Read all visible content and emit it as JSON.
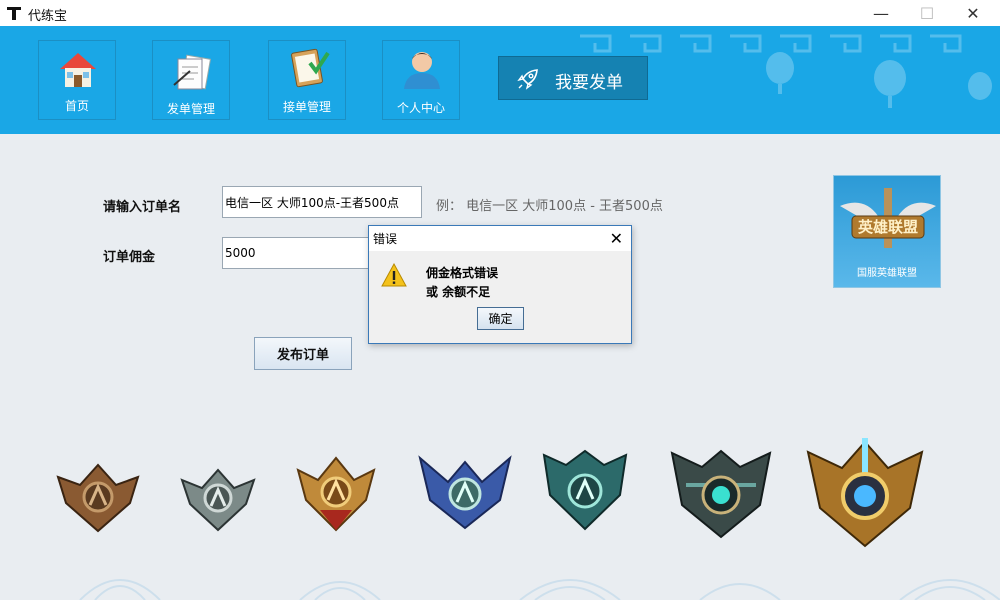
{
  "window": {
    "title": "代练宝",
    "min_icon": "minimize-icon",
    "max_icon": "maximize-icon",
    "close_icon": "close-icon"
  },
  "nav": [
    {
      "label": "首页",
      "icon": "home-icon"
    },
    {
      "label": "发单管理",
      "icon": "documents-icon"
    },
    {
      "label": "接单管理",
      "icon": "clipboard-check-icon"
    },
    {
      "label": "个人中心",
      "icon": "user-icon"
    }
  ],
  "publish_button": {
    "label": "我要发单",
    "icon": "rocket-icon"
  },
  "form": {
    "order_name_label": "请输入订单名",
    "order_name_value": "电信一区 大师100点-王者500点",
    "hint": "例：  电信一区 大师100点 - 王者500点",
    "commission_label": "订单佣金",
    "commission_value": "5000",
    "submit_label": "发布订单"
  },
  "logo": {
    "image_text": "英雄联盟",
    "caption": "国服英雄联盟"
  },
  "dialog": {
    "title": "错误",
    "message_line1": "佣金格式错误",
    "message_line2": "或 余额不足",
    "ok_label": "确定",
    "icon": "warning-icon"
  },
  "emblems": [
    "bronze-emblem-icon",
    "silver-emblem-icon",
    "gold-emblem-icon",
    "platinum-emblem-icon",
    "diamond-emblem-icon",
    "master-emblem-icon",
    "challenger-emblem-icon"
  ],
  "colors": {
    "header": "#1aa7e6",
    "publish_button": "#1582b2",
    "background": "#e9edf1"
  }
}
